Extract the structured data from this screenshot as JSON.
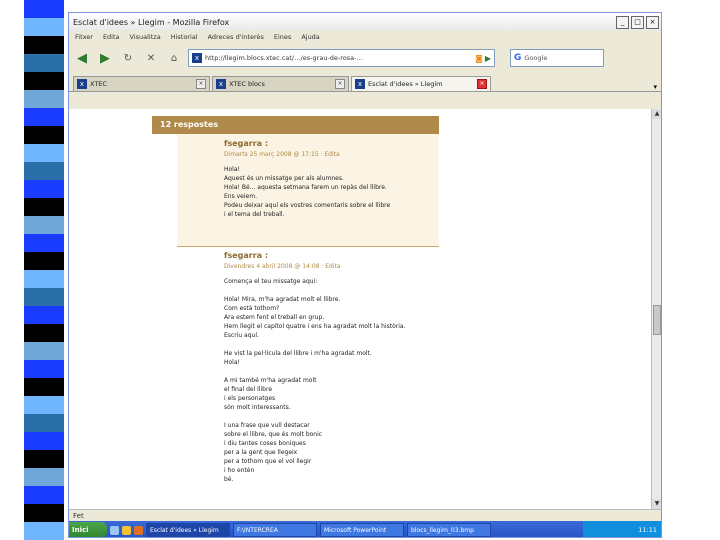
{
  "slide": {
    "stripe_colors": [
      "#1a3cff",
      "#6fb6ff",
      "#000000",
      "#2b6fa8",
      "#000000",
      "#6fa8d8",
      "#1a3cff",
      "#000000",
      "#6fb6ff",
      "#2b6fa8",
      "#1a3cff",
      "#000000",
      "#6fa8d8",
      "#1a3cff",
      "#000000",
      "#6fb6ff",
      "#2b6fa8",
      "#1a3cff",
      "#000000",
      "#6fa8d8",
      "#1a3cff",
      "#000000",
      "#6fb6ff",
      "#2b6fa8",
      "#1a3cff",
      "#000000",
      "#6fa8d8",
      "#1a3cff",
      "#000000",
      "#6fb6ff"
    ]
  },
  "browser": {
    "window_title": "Esclat d'idees » Llegim - Mozilla Firefox",
    "menu": [
      "Fitxer",
      "Edita",
      "Visualitza",
      "Historial",
      "Adreces d'interès",
      "Eines",
      "Ajuda"
    ],
    "url": "http://llegim.blocs.xtec.cat/…/es-grau-de-rosa-…",
    "search_placeholder": "Google",
    "tabs": [
      {
        "title": "XTEC",
        "active": false
      },
      {
        "title": "XTEC blocs",
        "active": false
      },
      {
        "title": "Esclat d'idees » Llegim",
        "active": true
      }
    ],
    "status": "Fet"
  },
  "page": {
    "responses_header": "12 respostes",
    "comments": [
      {
        "author": "fsegarra :",
        "date": "Dimarts 25 març 2008 @ 17:15 · Edita",
        "lines": [
          "Hola!",
          "Aquest és un missatge per als alumnes.",
          "Hola! Bé... aquesta setmana farem un repàs del llibre.",
          "Ens veiem.",
          "Podeu deixar aquí els vostres comentaris sobre el llibre",
          "i el tema del treball."
        ]
      },
      {
        "author": "fsegarra :",
        "date": "Divendres 4 abril 2008 @ 14:08 · Edita",
        "lines": [
          "Comença el teu missatge aquí:",
          "",
          "Hola! Mira, m'ha agradat molt el llibre.",
          "Com està tothom?",
          "Ara estem fent el treball en grup.",
          "Hem llegit el capítol quatre i ens ha agradat molt la història.",
          "Escriu aquí.",
          "",
          "He vist la pel·lícula del llibre i m'ha agradat molt.",
          "Hola!",
          "",
          "A mi també m'ha agradat molt",
          "el final del llibre",
          "i els personatges",
          "són molt interessants.",
          "",
          "I una frase que vull destacar",
          "sobre el llibre, que és molt bonic",
          "i diu tantes coses boniques",
          "per a la gent que llegeix",
          "per a tothom que el vol llegir",
          "i ho entén",
          "bé."
        ]
      }
    ]
  },
  "taskbar": {
    "start_label": "Inici",
    "tasks": [
      {
        "label": "Esclat d'idees » Llegim",
        "active": true
      },
      {
        "label": "F:\\INTERCREA",
        "active": false
      },
      {
        "label": "Microsoft PowerPoint",
        "active": false
      },
      {
        "label": "blocs_llegim_03.bmp",
        "active": false
      }
    ],
    "clock": "11:11"
  }
}
